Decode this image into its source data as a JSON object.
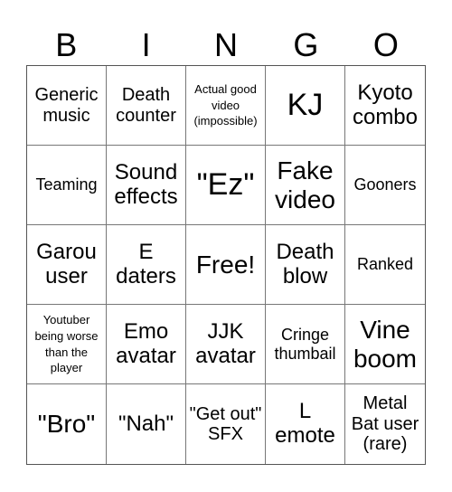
{
  "header": {
    "letters": [
      "B",
      "I",
      "N",
      "G",
      "O"
    ]
  },
  "cells": [
    "Generic music",
    "Death counter",
    "Actual good video (impossible)",
    "KJ",
    "Kyoto combo",
    "Teaming",
    "Sound effects",
    "\"Ez\"",
    "Fake video",
    "Gooners",
    "Garou user",
    "E daters",
    "Free!",
    "Death blow",
    "Ranked",
    "Youtuber being worse than the player",
    "Emo avatar",
    "JJK avatar",
    "Cringe thumbail",
    "Vine boom",
    "\"Bro\"",
    "\"Nah\"",
    "\"Get out\" SFX",
    "L emote",
    "Metal Bat user (rare)"
  ]
}
